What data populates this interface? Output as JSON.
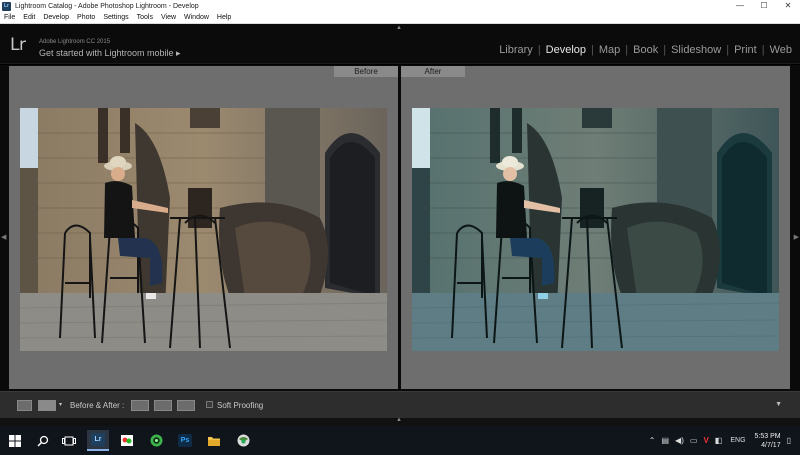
{
  "window": {
    "title": "Lightroom Catalog - Adobe Photoshop Lightroom - Develop",
    "controls": {
      "minimize": "—",
      "maximize": "☐",
      "close": "✕"
    }
  },
  "menu": [
    "File",
    "Edit",
    "Develop",
    "Photo",
    "Settings",
    "Tools",
    "View",
    "Window",
    "Help"
  ],
  "identity": {
    "logo": "Lr",
    "edition": "Adobe Lightroom CC 2015",
    "cta": "Get started with Lightroom mobile ▸"
  },
  "modules": [
    {
      "label": "Library",
      "active": false
    },
    {
      "label": "Develop",
      "active": true
    },
    {
      "label": "Map",
      "active": false
    },
    {
      "label": "Book",
      "active": false
    },
    {
      "label": "Slideshow",
      "active": false
    },
    {
      "label": "Print",
      "active": false
    },
    {
      "label": "Web",
      "active": false
    }
  ],
  "view": {
    "before_label": "Before",
    "after_label": "After"
  },
  "toolbar": {
    "before_after_label": "Before & After :",
    "soft_proofing_label": "Soft Proofing"
  },
  "taskbar": {
    "language": "ENG",
    "time": "5:53 PM",
    "date": "4/7/17"
  },
  "icons": {
    "start": "windows-start-icon",
    "search": "search-icon",
    "task_view": "task-view-icon",
    "lightroom": "lightroom-app-icon",
    "gallery": "photo-gallery-icon",
    "app_green": "green-circle-app-icon",
    "photoshop": "photoshop-app-icon",
    "explorer": "file-explorer-icon",
    "browser": "browser-icon"
  },
  "colors": {
    "module_active": "#e6e6e6",
    "module_inactive": "#9a9a9a",
    "panel_bg": "#6e6e6e",
    "after_tint": "#1f6e78"
  }
}
